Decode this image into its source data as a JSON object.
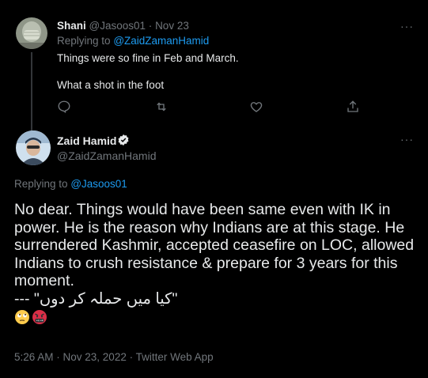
{
  "reply_tweet": {
    "author_name": "Shani",
    "author_handle": "@Jasoos01",
    "separator": "·",
    "date": "Nov 23",
    "replying_prefix": "Replying to",
    "replying_to": "@ZaidZamanHamid",
    "text_line1": "Things were so fine in Feb and March.",
    "text_line2": "What a shot in the foot",
    "more_label": "···",
    "actions": [
      "reply-icon",
      "retweet-icon",
      "like-icon",
      "share-icon"
    ]
  },
  "main_tweet": {
    "author_name": "Zaid Hamid",
    "author_handle": "@ZaidZamanHamid",
    "verified_icon": "verified-badge-icon",
    "more_label": "···",
    "replying_prefix": "Replying to",
    "replying_to": "@Jasoos01",
    "body": "No dear. Things would have been same even with IK in power. He is the reason why Indians are at this stage. He surrendered Kashmir, accepted ceasefire on LOC, allowed Indians to crush resistance & prepare for 3 years for this moment.",
    "urdu_line": "\"کیا میں حملہ کر دوں\" ---",
    "emojis": [
      "face-with-rolling-eyes-icon",
      "face-with-symbols-on-mouth-icon"
    ],
    "timestamp": "5:26 AM · Nov 23, 2022 · Twitter Web App"
  },
  "colors": {
    "background": "#000000",
    "text": "#e7e9ea",
    "muted": "#71767b",
    "link": "#1d9bf0"
  }
}
